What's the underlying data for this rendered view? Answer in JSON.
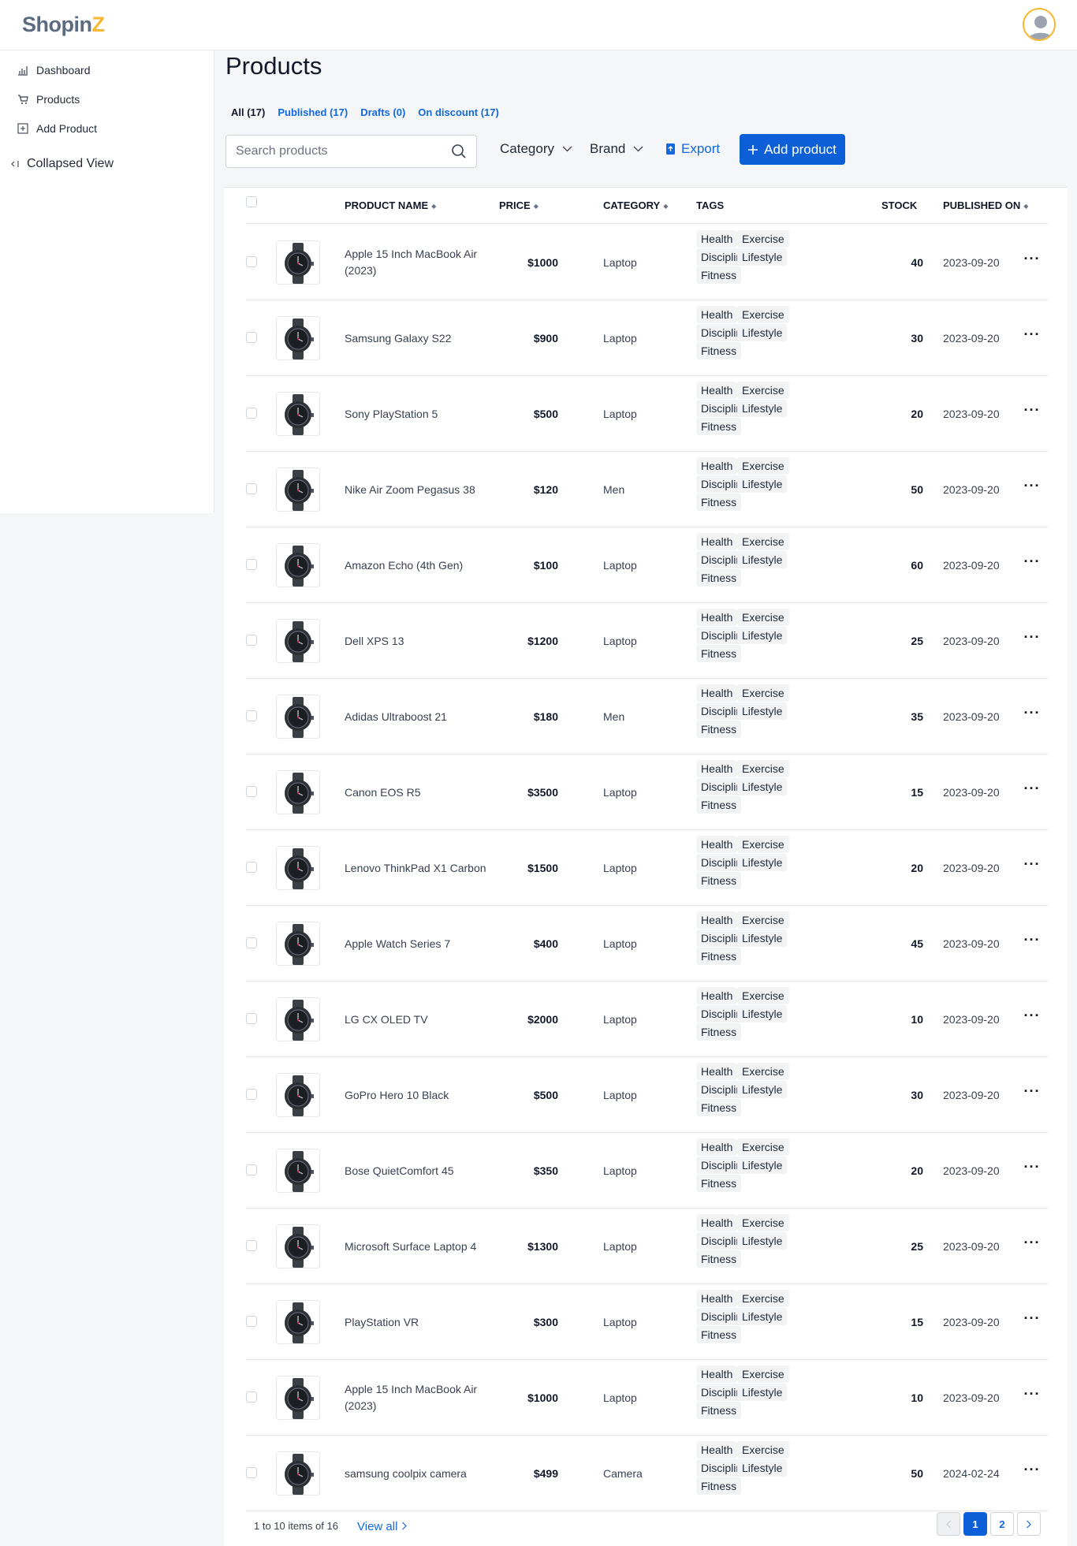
{
  "header": {
    "logo_main": "Shopin",
    "logo_accent": "Z"
  },
  "sidebar": {
    "items": [
      {
        "label": "Dashboard",
        "icon": "bar-chart-icon"
      },
      {
        "label": "Products",
        "icon": "cart-icon"
      },
      {
        "label": "Add Product",
        "icon": "plus-square-icon"
      }
    ],
    "collapse_label": "Collapsed View"
  },
  "page": {
    "title": "Products"
  },
  "filters": [
    {
      "label": "All (17)",
      "active": true
    },
    {
      "label": "Published (17)",
      "active": false
    },
    {
      "label": "Drafts (0)",
      "active": false
    },
    {
      "label": "On discount (17)",
      "active": false
    }
  ],
  "toolbar": {
    "search_placeholder": "Search products",
    "category_label": "Category",
    "brand_label": "Brand",
    "export_label": "Export",
    "add_label": "Add product"
  },
  "columns": {
    "name": "Product name",
    "price": "Price",
    "category": "Category",
    "tags": "Tags",
    "stock": "Stock",
    "published": "Published on"
  },
  "tag_labels": [
    "Health",
    "Exercise",
    "Discipline",
    "Lifestyle",
    "Fitness"
  ],
  "products": [
    {
      "name": "Apple 15 Inch MacBook Air (2023)",
      "price": "$1000",
      "category": "Laptop",
      "stock": "40",
      "published": "2023-09-20"
    },
    {
      "name": "Samsung Galaxy S22",
      "price": "$900",
      "category": "Laptop",
      "stock": "30",
      "published": "2023-09-20"
    },
    {
      "name": "Sony PlayStation 5",
      "price": "$500",
      "category": "Laptop",
      "stock": "20",
      "published": "2023-09-20"
    },
    {
      "name": "Nike Air Zoom Pegasus 38",
      "price": "$120",
      "category": "Men",
      "stock": "50",
      "published": "2023-09-20"
    },
    {
      "name": "Amazon Echo (4th Gen)",
      "price": "$100",
      "category": "Laptop",
      "stock": "60",
      "published": "2023-09-20"
    },
    {
      "name": "Dell XPS 13",
      "price": "$1200",
      "category": "Laptop",
      "stock": "25",
      "published": "2023-09-20"
    },
    {
      "name": "Adidas Ultraboost 21",
      "price": "$180",
      "category": "Men",
      "stock": "35",
      "published": "2023-09-20"
    },
    {
      "name": "Canon EOS R5",
      "price": "$3500",
      "category": "Laptop",
      "stock": "15",
      "published": "2023-09-20"
    },
    {
      "name": "Lenovo ThinkPad X1 Carbon",
      "price": "$1500",
      "category": "Laptop",
      "stock": "20",
      "published": "2023-09-20"
    },
    {
      "name": "Apple Watch Series 7",
      "price": "$400",
      "category": "Laptop",
      "stock": "45",
      "published": "2023-09-20"
    },
    {
      "name": "LG CX OLED TV",
      "price": "$2000",
      "category": "Laptop",
      "stock": "10",
      "published": "2023-09-20"
    },
    {
      "name": "GoPro Hero 10 Black",
      "price": "$500",
      "category": "Laptop",
      "stock": "30",
      "published": "2023-09-20"
    },
    {
      "name": "Bose QuietComfort 45",
      "price": "$350",
      "category": "Laptop",
      "stock": "20",
      "published": "2023-09-20"
    },
    {
      "name": "Microsoft Surface Laptop 4",
      "price": "$1300",
      "category": "Laptop",
      "stock": "25",
      "published": "2023-09-20"
    },
    {
      "name": "PlayStation VR",
      "price": "$300",
      "category": "Laptop",
      "stock": "15",
      "published": "2023-09-20"
    },
    {
      "name": "Apple 15 Inch MacBook Air (2023)",
      "price": "$1000",
      "category": "Laptop",
      "stock": "10",
      "published": "2023-09-20"
    },
    {
      "name": "samsung coolpix camera",
      "price": "$499",
      "category": "Camera",
      "stock": "50",
      "published": "2024-02-24"
    }
  ],
  "footer": {
    "info": "1 to 10 items of 16",
    "view_all": "View all",
    "pages": [
      "1",
      "2"
    ],
    "current_page": "1"
  },
  "colors": {
    "brand": "#5b6b80",
    "accent": "#f5b82e",
    "primary": "#0d5fd8",
    "link": "#1268e0"
  }
}
